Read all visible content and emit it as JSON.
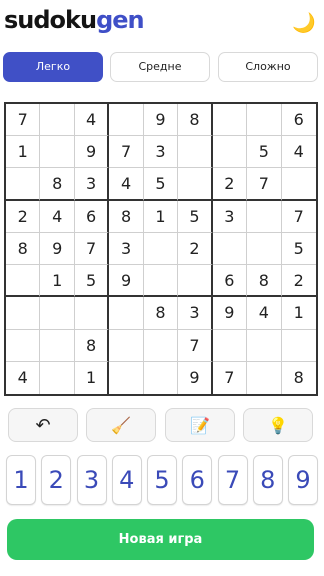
{
  "app": {
    "logo_part1": "sudoku",
    "logo_part2": "gen",
    "theme_icon": "moon-icon"
  },
  "difficulty": {
    "options": [
      "Легко",
      "Средне",
      "Сложно"
    ],
    "selected": "Легко"
  },
  "board": [
    [
      "7",
      "",
      "4",
      "",
      "9",
      "8",
      "",
      "",
      "6"
    ],
    [
      "1",
      "",
      "9",
      "7",
      "3",
      "",
      "",
      "5",
      "4"
    ],
    [
      "",
      "8",
      "3",
      "4",
      "5",
      "",
      "2",
      "7",
      ""
    ],
    [
      "2",
      "4",
      "6",
      "8",
      "1",
      "5",
      "3",
      "",
      "7"
    ],
    [
      "8",
      "9",
      "7",
      "3",
      "",
      "2",
      "",
      "",
      "5"
    ],
    [
      "",
      "1",
      "5",
      "9",
      "",
      "",
      "6",
      "8",
      "2"
    ],
    [
      "",
      "",
      "",
      "",
      "8",
      "3",
      "9",
      "4",
      "1"
    ],
    [
      "",
      "",
      "8",
      "",
      "",
      "7",
      "",
      "",
      ""
    ],
    [
      "4",
      "",
      "1",
      "",
      "",
      "9",
      "7",
      "",
      "8"
    ]
  ],
  "tools": [
    {
      "name": "undo-button",
      "icon": "undo-icon",
      "glyph": "↶"
    },
    {
      "name": "erase-button",
      "icon": "broom-icon",
      "glyph": "🧹"
    },
    {
      "name": "notes-button",
      "icon": "notepad-pencil-icon",
      "glyph": "📝"
    },
    {
      "name": "hint-button",
      "icon": "lightbulb-icon",
      "glyph": "💡"
    }
  ],
  "numpad": [
    "1",
    "2",
    "3",
    "4",
    "5",
    "6",
    "7",
    "8",
    "9"
  ],
  "new_game_label": "Новая игра",
  "colors": {
    "accent": "#4050c6",
    "number_color": "#3a4ab8",
    "new_game": "#2ec764"
  }
}
